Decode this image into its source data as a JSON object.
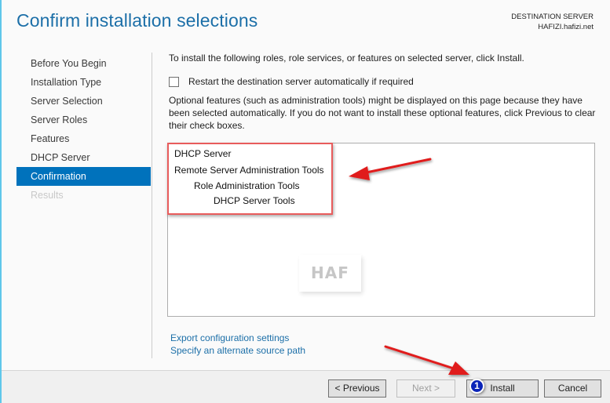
{
  "header": {
    "title": "Confirm installation selections",
    "destination_label": "DESTINATION SERVER",
    "destination_server": "HAFIZI.hafizi.net"
  },
  "sidebar": {
    "items": [
      {
        "label": "Before You Begin",
        "state": "normal"
      },
      {
        "label": "Installation Type",
        "state": "normal"
      },
      {
        "label": "Server Selection",
        "state": "normal"
      },
      {
        "label": "Server Roles",
        "state": "normal"
      },
      {
        "label": "Features",
        "state": "normal"
      },
      {
        "label": "DHCP Server",
        "state": "normal"
      },
      {
        "label": "Confirmation",
        "state": "active"
      },
      {
        "label": "Results",
        "state": "disabled"
      }
    ]
  },
  "main": {
    "intro": "To install the following roles, role services, or features on selected server, click Install.",
    "restart_checkbox": {
      "label": "Restart the destination server automatically if required",
      "checked": false
    },
    "note": "Optional features (such as administration tools) might be displayed on this page because they have been selected automatically. If you do not want to install these optional features, click Previous to clear their check boxes.",
    "selections": [
      {
        "label": "DHCP Server",
        "level": 0
      },
      {
        "label": "Remote Server Administration Tools",
        "level": 0
      },
      {
        "label": "Role Administration Tools",
        "level": 1
      },
      {
        "label": "DHCP Server Tools",
        "level": 2
      }
    ],
    "watermark": "HAF",
    "links": {
      "export": "Export configuration settings",
      "alternate_source": "Specify an alternate source path"
    }
  },
  "footer": {
    "previous_label": "< Previous",
    "next_label": "Next >",
    "install_label": "Install",
    "cancel_label": "Cancel",
    "step_badge": "1"
  },
  "annotations": {
    "highlight_color": "#e85c5c",
    "arrow_color": "#e01b1b",
    "badge_color": "#0a24b8"
  },
  "colors": {
    "accent": "#0072bc",
    "title": "#1c6fa8",
    "link": "#1c6fa8"
  }
}
